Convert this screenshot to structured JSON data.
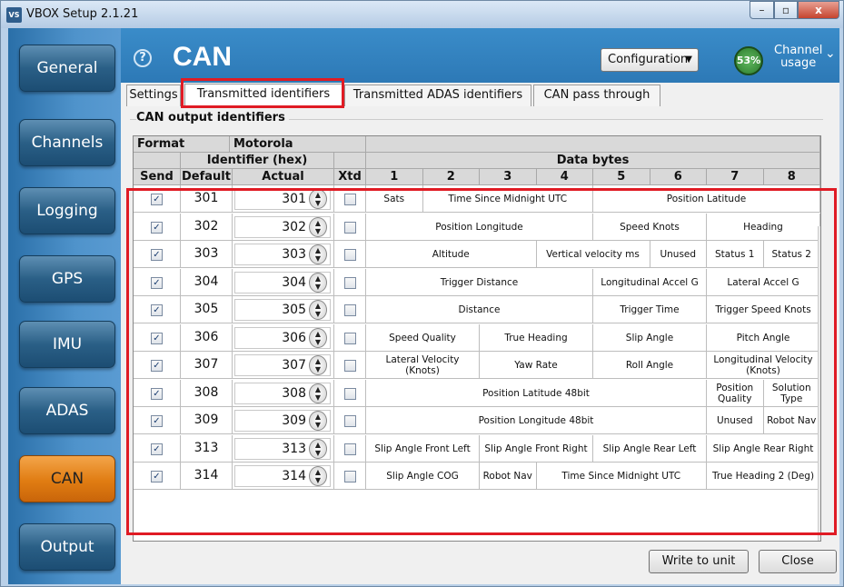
{
  "window": {
    "title": "VBOX Setup 2.1.21",
    "app_icon": "VS",
    "min": "–",
    "max": "▫",
    "close": "x"
  },
  "sidebar": {
    "items": [
      "General",
      "Channels",
      "Logging",
      "GPS",
      "IMU",
      "ADAS",
      "CAN",
      "Output"
    ],
    "active": "CAN"
  },
  "header": {
    "help": "?",
    "title": "CAN",
    "config_label": "Configuration",
    "gauge_value": "53%",
    "channel_usage": [
      "Channel",
      "usage"
    ]
  },
  "tabs": [
    "Settings",
    "Transmitted identifiers",
    "Transmitted ADAS identifiers",
    "CAN pass through"
  ],
  "panel": {
    "group_title": "CAN output identifiers"
  },
  "table": {
    "format_label": "Format",
    "format_value": "Motorola",
    "identifier_hex": "Identifier (hex)",
    "data_bytes": "Data bytes",
    "cols": [
      "Send",
      "Default",
      "Actual",
      "Xtd"
    ],
    "byte_nums": [
      "1",
      "2",
      "3",
      "4",
      "5",
      "6",
      "7",
      "8"
    ],
    "rows": [
      {
        "send": true,
        "default": "301",
        "actual": "301",
        "xtd": false,
        "cells": [
          [
            "Sats",
            1
          ],
          [
            "Time Since Midnight UTC",
            3
          ],
          [
            "Position Latitude",
            4
          ]
        ]
      },
      {
        "send": true,
        "default": "302",
        "actual": "302",
        "xtd": false,
        "cells": [
          [
            "Position Longitude",
            4
          ],
          [
            "Speed Knots",
            2
          ],
          [
            "Heading",
            2
          ]
        ]
      },
      {
        "send": true,
        "default": "303",
        "actual": "303",
        "xtd": false,
        "cells": [
          [
            "Altitude",
            3
          ],
          [
            "Vertical velocity ms",
            2
          ],
          [
            "Unused",
            1
          ],
          [
            "Status 1",
            1
          ],
          [
            "Status 2",
            1
          ]
        ]
      },
      {
        "send": true,
        "default": "304",
        "actual": "304",
        "xtd": false,
        "cells": [
          [
            "Trigger Distance",
            4
          ],
          [
            "Longitudinal Accel G",
            2
          ],
          [
            "Lateral Accel G",
            2
          ]
        ]
      },
      {
        "send": true,
        "default": "305",
        "actual": "305",
        "xtd": false,
        "cells": [
          [
            "Distance",
            4
          ],
          [
            "Trigger Time",
            2
          ],
          [
            "Trigger Speed Knots",
            2
          ]
        ]
      },
      {
        "send": true,
        "default": "306",
        "actual": "306",
        "xtd": false,
        "cells": [
          [
            "Speed Quality",
            2
          ],
          [
            "True Heading",
            2
          ],
          [
            "Slip Angle",
            2
          ],
          [
            "Pitch Angle",
            2
          ]
        ]
      },
      {
        "send": true,
        "default": "307",
        "actual": "307",
        "xtd": false,
        "cells": [
          [
            "Lateral Velocity (Knots)",
            2
          ],
          [
            "Yaw Rate",
            2
          ],
          [
            "Roll Angle",
            2
          ],
          [
            "Longitudinal Velocity (Knots)",
            2
          ]
        ]
      },
      {
        "send": true,
        "default": "308",
        "actual": "308",
        "xtd": false,
        "cells": [
          [
            "Position Latitude 48bit",
            6
          ],
          [
            "Position Quality",
            1
          ],
          [
            "Solution Type",
            1
          ]
        ]
      },
      {
        "send": true,
        "default": "309",
        "actual": "309",
        "xtd": false,
        "cells": [
          [
            "Position Longitude 48bit",
            6
          ],
          [
            "Unused",
            1
          ],
          [
            "Robot Nav",
            1
          ]
        ]
      },
      {
        "send": true,
        "default": "313",
        "actual": "313",
        "xtd": false,
        "cells": [
          [
            "Slip Angle Front Left",
            2
          ],
          [
            "Slip Angle Front Right",
            2
          ],
          [
            "Slip Angle Rear Left",
            2
          ],
          [
            "Slip Angle Rear Right",
            2
          ]
        ]
      },
      {
        "send": true,
        "default": "314",
        "actual": "314",
        "xtd": false,
        "cells": [
          [
            "Slip Angle COG",
            2
          ],
          [
            "Robot Nav",
            1
          ],
          [
            "Time Since Midnight UTC",
            3
          ],
          [
            "True Heading 2 (Deg)",
            2
          ]
        ]
      }
    ]
  },
  "buttons": {
    "write": "Write to unit",
    "close": "Close"
  },
  "colors": {
    "highlight": "#e01b24",
    "active_nav": "#e07c12",
    "header": "#2d79b6"
  }
}
